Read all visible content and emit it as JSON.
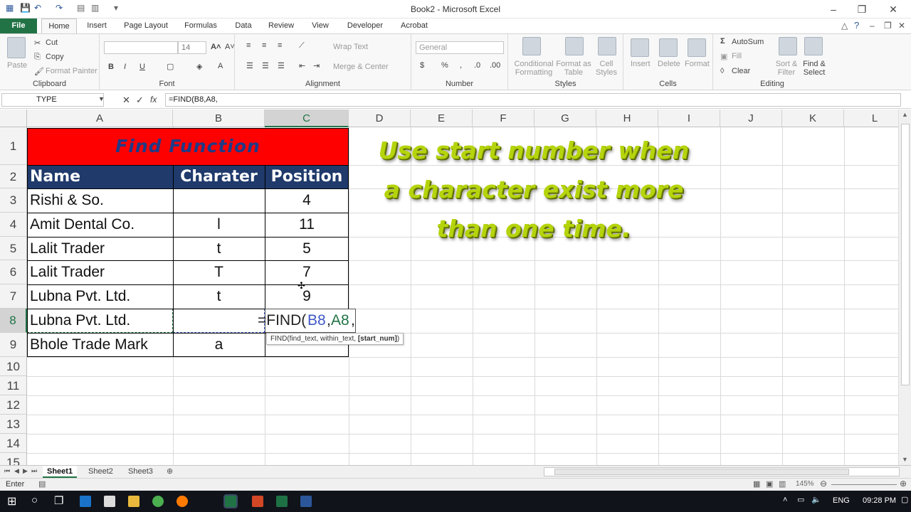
{
  "window": {
    "title": "Book2 - Microsoft Excel"
  },
  "tabs": [
    "File",
    "Home",
    "Insert",
    "Page Layout",
    "Formulas",
    "Data",
    "Review",
    "View",
    "Developer",
    "Acrobat"
  ],
  "ribbon": {
    "clipboard": {
      "paste": "Paste",
      "cut": "Cut",
      "copy": "Copy",
      "format_painter": "Format Painter",
      "label": "Clipboard"
    },
    "font": {
      "size": "14",
      "label": "Font"
    },
    "alignment": {
      "wrap": "Wrap Text",
      "merge": "Merge & Center",
      "label": "Alignment"
    },
    "number": {
      "format": "General",
      "label": "Number"
    },
    "styles": {
      "conditional": "Conditional Formatting",
      "format_table": "Format as Table",
      "cell_styles": "Cell Styles",
      "label": "Styles"
    },
    "cells": {
      "insert": "Insert",
      "delete": "Delete",
      "format": "Format",
      "label": "Cells"
    },
    "editing": {
      "autosum": "AutoSum",
      "fill": "Fill",
      "clear": "Clear",
      "sort": "Sort & Filter",
      "find": "Find & Select",
      "label": "Editing"
    }
  },
  "formula_bar": {
    "name_box": "TYPE",
    "formula": "=FIND(B8,A8,"
  },
  "columns": [
    "A",
    "B",
    "C",
    "D",
    "E",
    "F",
    "G",
    "H",
    "I",
    "J",
    "K",
    "L"
  ],
  "rows": [
    "1",
    "2",
    "3",
    "4",
    "5",
    "6",
    "7",
    "8",
    "9",
    "10",
    "11",
    "12",
    "13",
    "14",
    "15"
  ],
  "table": {
    "title": "Find Function",
    "headers": [
      "Name",
      "Charater",
      "Position"
    ],
    "data": [
      [
        "Rishi & So.",
        "",
        "4"
      ],
      [
        "Amit Dental Co.",
        "l",
        "11"
      ],
      [
        "Lalit Trader",
        "t",
        "5"
      ],
      [
        "Lalit Trader",
        "T",
        "7"
      ],
      [
        "Lubna Pvt. Ltd.",
        "t",
        "9"
      ],
      [
        "Lubna Pvt. Ltd.",
        "",
        ""
      ],
      [
        "Bhole Trade Mark",
        "a",
        ""
      ]
    ],
    "editing_formula": {
      "prefix": "=FIND(",
      "arg1": "B8",
      "sep": ",",
      "arg2": "A8",
      "suffix": ","
    }
  },
  "tooltip": {
    "text": "FIND(find_text, within_text, ",
    "bold": "[start_num]",
    "close": ")"
  },
  "annotation": [
    "Use start number when",
    "a character exist more",
    "than one time."
  ],
  "sheets": [
    "Sheet1",
    "Sheet2",
    "Sheet3"
  ],
  "status": {
    "mode": "Enter",
    "zoom": "145%"
  },
  "taskbar": {
    "lang": "ENG",
    "time": "09:28 PM"
  },
  "colors": {
    "excel_green": "#217346",
    "title_red": "#ff0000",
    "header_navy": "#1f3a6b",
    "annotation": "#b5d40c"
  }
}
